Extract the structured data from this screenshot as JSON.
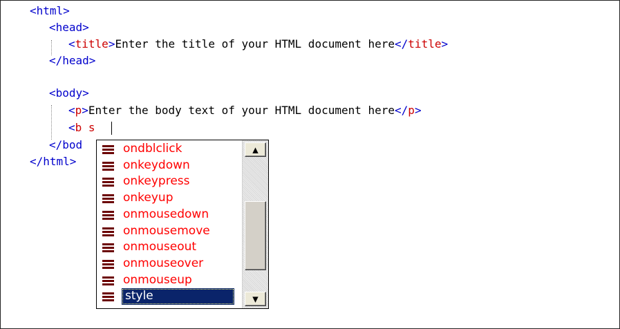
{
  "editor": {
    "lines": [
      {
        "lt": "<",
        "tag": "html",
        "gt": ">"
      },
      {
        "lt": "<",
        "tag": "head",
        "gt": ">"
      },
      {
        "open_lt": "<",
        "open_tag": "title",
        "open_gt": ">",
        "text": "Enter the title of your HTML document here",
        "close_lt": "</",
        "close_tag": "title",
        "close_gt": ">"
      },
      {
        "lt": "</",
        "tag": "head",
        "gt": ">"
      },
      {
        "lt": "<",
        "tag": "body",
        "gt": ">"
      },
      {
        "open_lt": "<",
        "open_tag": "p",
        "open_gt": ">",
        "text": "Enter the body text of your HTML document here",
        "close_lt": "</",
        "close_tag": "p",
        "close_gt": ">"
      },
      {
        "lt": "<",
        "tag": "b",
        "typed": "s"
      },
      {
        "lt": "</",
        "tag": "bod",
        "gt": ""
      },
      {
        "lt": "</",
        "tag": "html",
        "gt": ">"
      }
    ]
  },
  "autocomplete": {
    "items": [
      "ondblclick",
      "onkeydown",
      "onkeypress",
      "onkeyup",
      "onmousedown",
      "onmousemove",
      "onmouseout",
      "onmouseover",
      "onmouseup",
      "style"
    ],
    "selected_index": 9,
    "item_icon": "attribute-icon",
    "scroll_up_icon": "▲",
    "scroll_down_icon": "▼"
  },
  "colors": {
    "tag": "#0000cc",
    "attribute": "#cc0000",
    "list_item": "#ff0000",
    "selection": "#0a246a"
  }
}
